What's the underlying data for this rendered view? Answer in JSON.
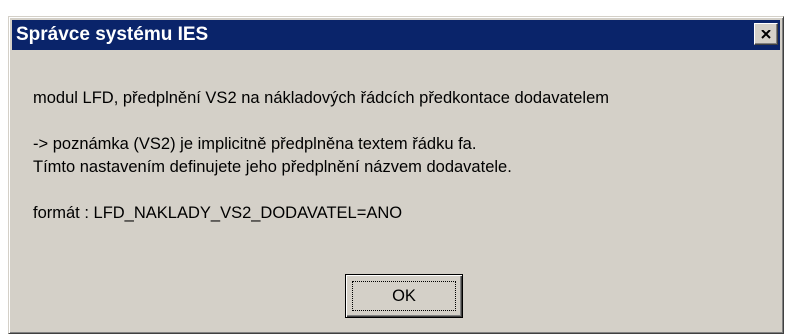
{
  "window": {
    "title": "Správce systému IES",
    "close_icon": "close-icon"
  },
  "message": {
    "line1": "modul LFD, předplnění VS2 na nákladových řádcích předkontace dodavatelem",
    "line2": "-> poznámka (VS2) je implicitně předplněna textem řádku fa.",
    "line3": "Tímto nastavením definujete jeho předplnění názvem dodavatele.",
    "line4": "formát : LFD_NAKLADY_VS2_DODAVATEL=ANO"
  },
  "buttons": {
    "ok_label": "OK"
  },
  "colors": {
    "titlebar": "#0a246a",
    "face": "#d4d0c8"
  }
}
